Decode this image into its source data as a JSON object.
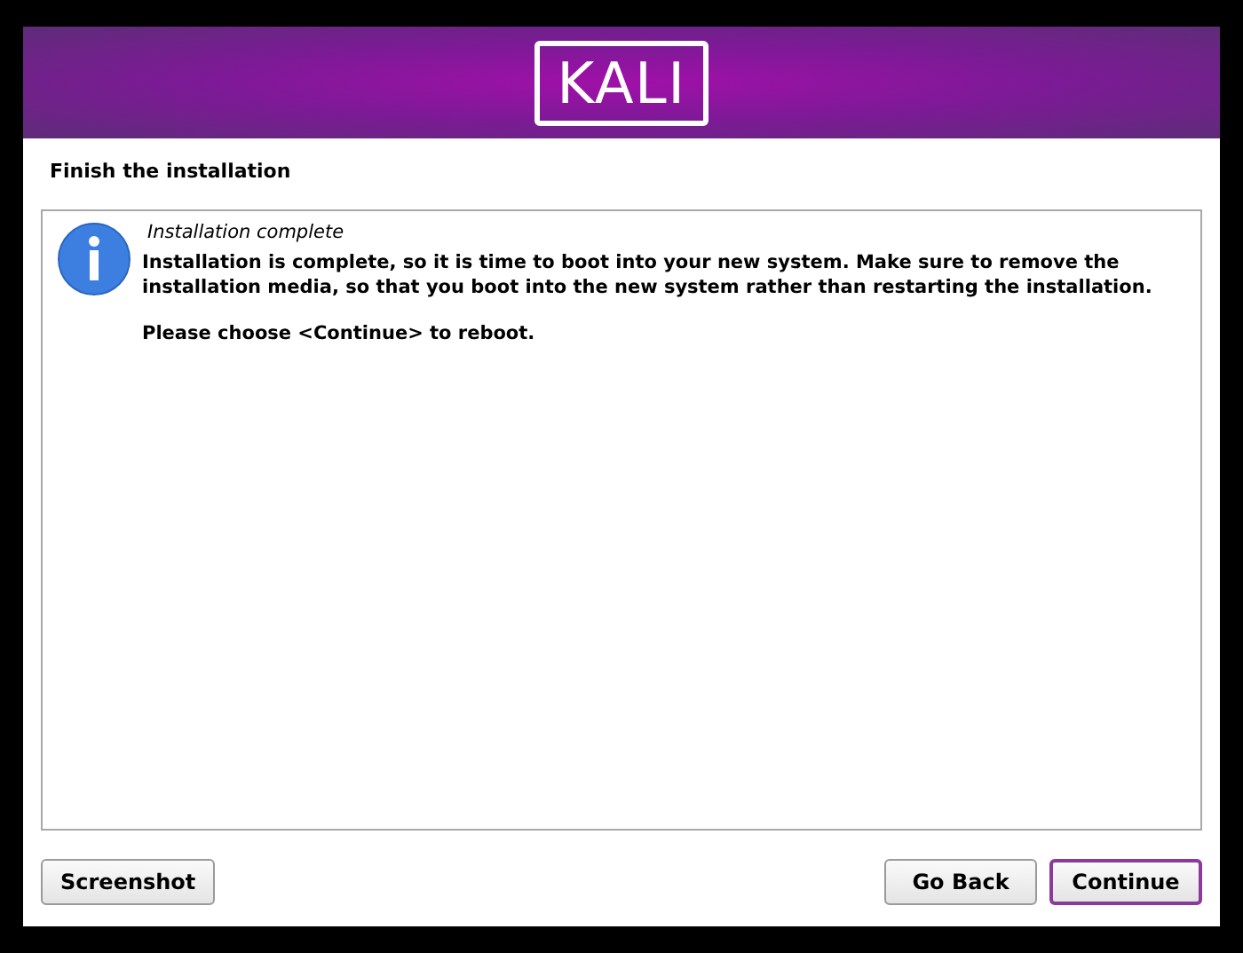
{
  "banner": {
    "logo": "KALI"
  },
  "title": "Finish the installation",
  "message": {
    "heading": "Installation complete",
    "body": "Installation is complete, so it is time to boot into your new system. Make sure to remove the installation media, so that you boot into the new system rather than restarting the installation.",
    "hint": "Please choose <Continue> to reboot."
  },
  "buttons_left": [
    {
      "label": "Screenshot",
      "focused": false
    }
  ],
  "buttons_right": [
    {
      "label": "Go Back",
      "focused": false
    },
    {
      "label": "Continue",
      "focused": true
    }
  ]
}
